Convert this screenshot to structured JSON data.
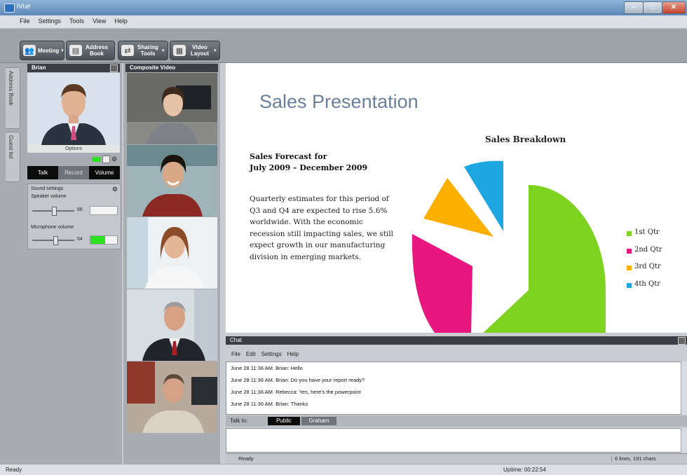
{
  "window": {
    "title": "iVue"
  },
  "menubar": [
    "File",
    "Settings",
    "Tools",
    "View",
    "Help"
  ],
  "toolbar": [
    {
      "label": "Meeting",
      "icon": "people-icon",
      "dropdown": true
    },
    {
      "label": "Address Book",
      "icon": "address-book-icon",
      "dropdown": false
    },
    {
      "label": "Sharing Tools",
      "icon": "sharing-icon",
      "dropdown": true
    },
    {
      "label": "Video Layout",
      "icon": "video-layout-icon",
      "dropdown": true
    }
  ],
  "side_tabs": [
    "Address Book",
    "Guest list"
  ],
  "participant_panel": {
    "name": "Brian",
    "options_label": "Options",
    "buttons": [
      "Talk",
      "Record",
      "Volume"
    ],
    "sound_settings_label": "Sound settings",
    "speaker_label": "Speaker volume",
    "speaker_value": "66",
    "speaker_level": 0.5,
    "mic_label": "Microphone volume",
    "mic_value": "64",
    "mic_level": 0.55
  },
  "composite_panel": {
    "title": "Composite Video"
  },
  "slide": {
    "title": "Sales Presentation",
    "forecast_line1": "Sales Forecast for",
    "forecast_line2": "July 2009 – December 2009",
    "body": "Quarterly estimates for this period of Q3 and Q4 are expected to rise 5.6% worldwide. With the economic recession still impacting sales, we still expect growth in our manufacturing division in emerging markets.",
    "chart_title": "Sales Breakdown",
    "legend": [
      {
        "label": "1st Qtr",
        "color": "#7ed321"
      },
      {
        "label": "2nd Qtr",
        "color": "#e8177f"
      },
      {
        "label": "3rd Qtr",
        "color": "#fbb000"
      },
      {
        "label": "4th Qtr",
        "color": "#1ea6e0"
      }
    ]
  },
  "chat": {
    "title": "Chat",
    "menu": [
      "File",
      "Edit",
      "Settings",
      "Help"
    ],
    "messages": [
      "June 28 11:36 AM. Brian: Hello",
      "June 28 11:36 AM. Brian: Do you have your report ready?",
      "June 28 11:36 AM. Rebecca: Yes, here's the powerpoint",
      "June 28 11:36 AM. Brian: Thanks"
    ],
    "talk_to_label": "Talk to:",
    "talk_tabs": [
      "Public",
      "Graham"
    ],
    "status": "Ready",
    "counter": "6 lines, 191 chars"
  },
  "statusbar": {
    "left": "Ready",
    "uptime": "Uptime: 00:22:54"
  }
}
